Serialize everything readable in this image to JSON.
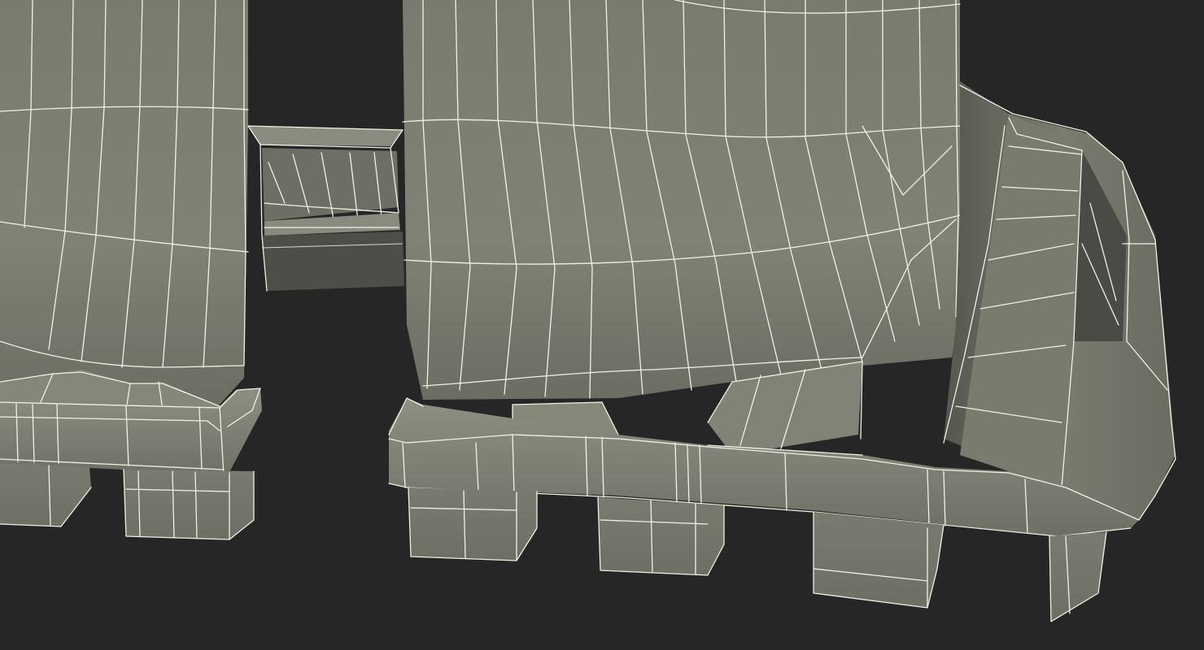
{
  "viewport": {
    "background_color": "#262626",
    "mesh_base_color": "#7d7e72",
    "mesh_shadow_color": "#4f5049",
    "mesh_highlight_color": "#8f9084",
    "wireframe_color": "#f2f0e6"
  }
}
